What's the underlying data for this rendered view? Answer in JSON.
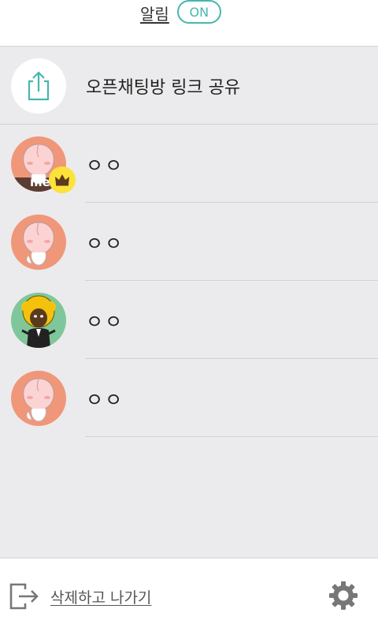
{
  "header": {
    "notification_label": "알림",
    "notification_toggle": "ON"
  },
  "share_row": {
    "label": "오픈채팅방 링크 공유",
    "icon": "share-icon"
  },
  "members": [
    {
      "name": "ㅇㅇ",
      "avatar": "peach-character",
      "is_me": true,
      "is_host": true,
      "me_label": "me",
      "bg": "#f0977a"
    },
    {
      "name": "ㅇㅇ",
      "avatar": "peach-character",
      "is_me": false,
      "is_host": false,
      "bg": "#f0977a"
    },
    {
      "name": "ㅇㅇ",
      "avatar": "afro-character",
      "is_me": false,
      "is_host": false,
      "bg": "#7fc79a"
    },
    {
      "name": "ㅇㅇ",
      "avatar": "peach-character",
      "is_me": false,
      "is_host": false,
      "bg": "#f0977a"
    }
  ],
  "footer": {
    "leave_label": "삭제하고 나가기",
    "leave_icon": "exit-icon",
    "settings_icon": "gear-icon"
  },
  "colors": {
    "accent": "#46b7ae",
    "host_badge": "#fde23a",
    "peach_bg": "#f0977a",
    "green_bg": "#7fc79a"
  }
}
